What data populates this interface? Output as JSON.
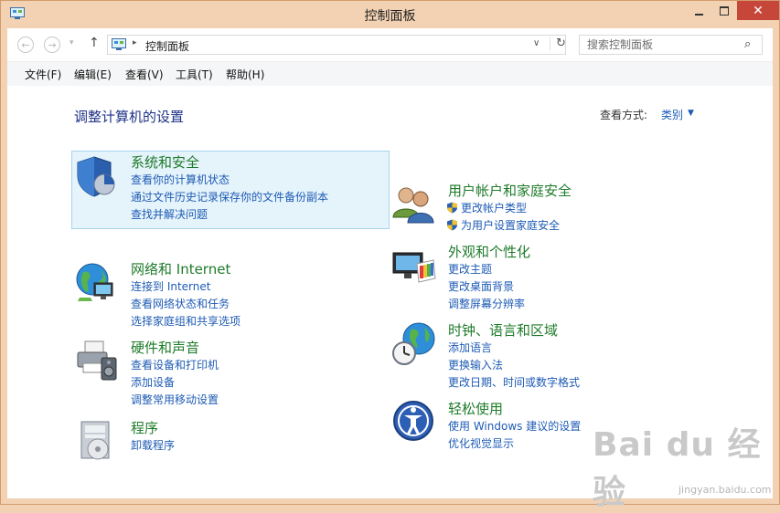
{
  "window": {
    "title": "控制面板",
    "minimize_glyph": "—",
    "close_glyph": "✕"
  },
  "nav": {
    "back_glyph": "←",
    "forward_glyph": "→",
    "dropdown_glyph": "▾",
    "up_glyph": "↑",
    "address_separator": "▸",
    "address_path": "控制面板",
    "address_dropdown_glyph": "∨",
    "refresh_glyph": "↻",
    "search_placeholder": "搜索控制面板",
    "search_glyph": "⌕"
  },
  "menu": [
    {
      "label": "文件(F)"
    },
    {
      "label": "编辑(E)"
    },
    {
      "label": "查看(V)"
    },
    {
      "label": "工具(T)"
    },
    {
      "label": "帮助(H)"
    }
  ],
  "content": {
    "title": "调整计算机的设置",
    "view_label": "查看方式:",
    "view_value": "类别",
    "view_arrow": "▼"
  },
  "categories": [
    {
      "title": "系统和安全",
      "icon": "shield-pie-icon",
      "links": [
        "查看你的计算机状态",
        "通过文件历史记录保存你的文件备份副本",
        "查找并解决问题"
      ]
    },
    {
      "title": "网络和 Internet",
      "icon": "network-globe-icon",
      "links": [
        "连接到 Internet",
        "查看网络状态和任务",
        "选择家庭组和共享选项"
      ]
    },
    {
      "title": "硬件和声音",
      "icon": "printer-speaker-icon",
      "links": [
        "查看设备和打印机",
        "添加设备",
        "调整常用移动设置"
      ]
    },
    {
      "title": "程序",
      "icon": "programs-disc-icon",
      "links": [
        "卸载程序"
      ]
    },
    {
      "title": "用户帐户和家庭安全",
      "icon": "users-icon",
      "links": [
        "更改帐户类型",
        "为用户设置家庭安全"
      ]
    },
    {
      "title": "外观和个性化",
      "icon": "monitor-palette-icon",
      "links": [
        "更改主题",
        "更改桌面背景",
        "调整屏幕分辨率"
      ]
    },
    {
      "title": "时钟、语言和区域",
      "icon": "globe-clock-icon",
      "links": [
        "添加语言",
        "更换输入法",
        "更改日期、时间或数字格式"
      ]
    },
    {
      "title": "轻松使用",
      "icon": "ease-of-access-icon",
      "links": [
        "使用 Windows 建议的设置",
        "优化视觉显示"
      ]
    }
  ],
  "watermark": {
    "logo": "Bai du 经验",
    "sub": "jingyan.baidu.com"
  },
  "colors": {
    "title_bar": "#f3d2b3",
    "close_button": "#c7463a",
    "category_title": "#1e7b2a",
    "link": "#1e5bb4",
    "page_title": "#1e3287",
    "highlight_bg": "#e5f3fb"
  }
}
